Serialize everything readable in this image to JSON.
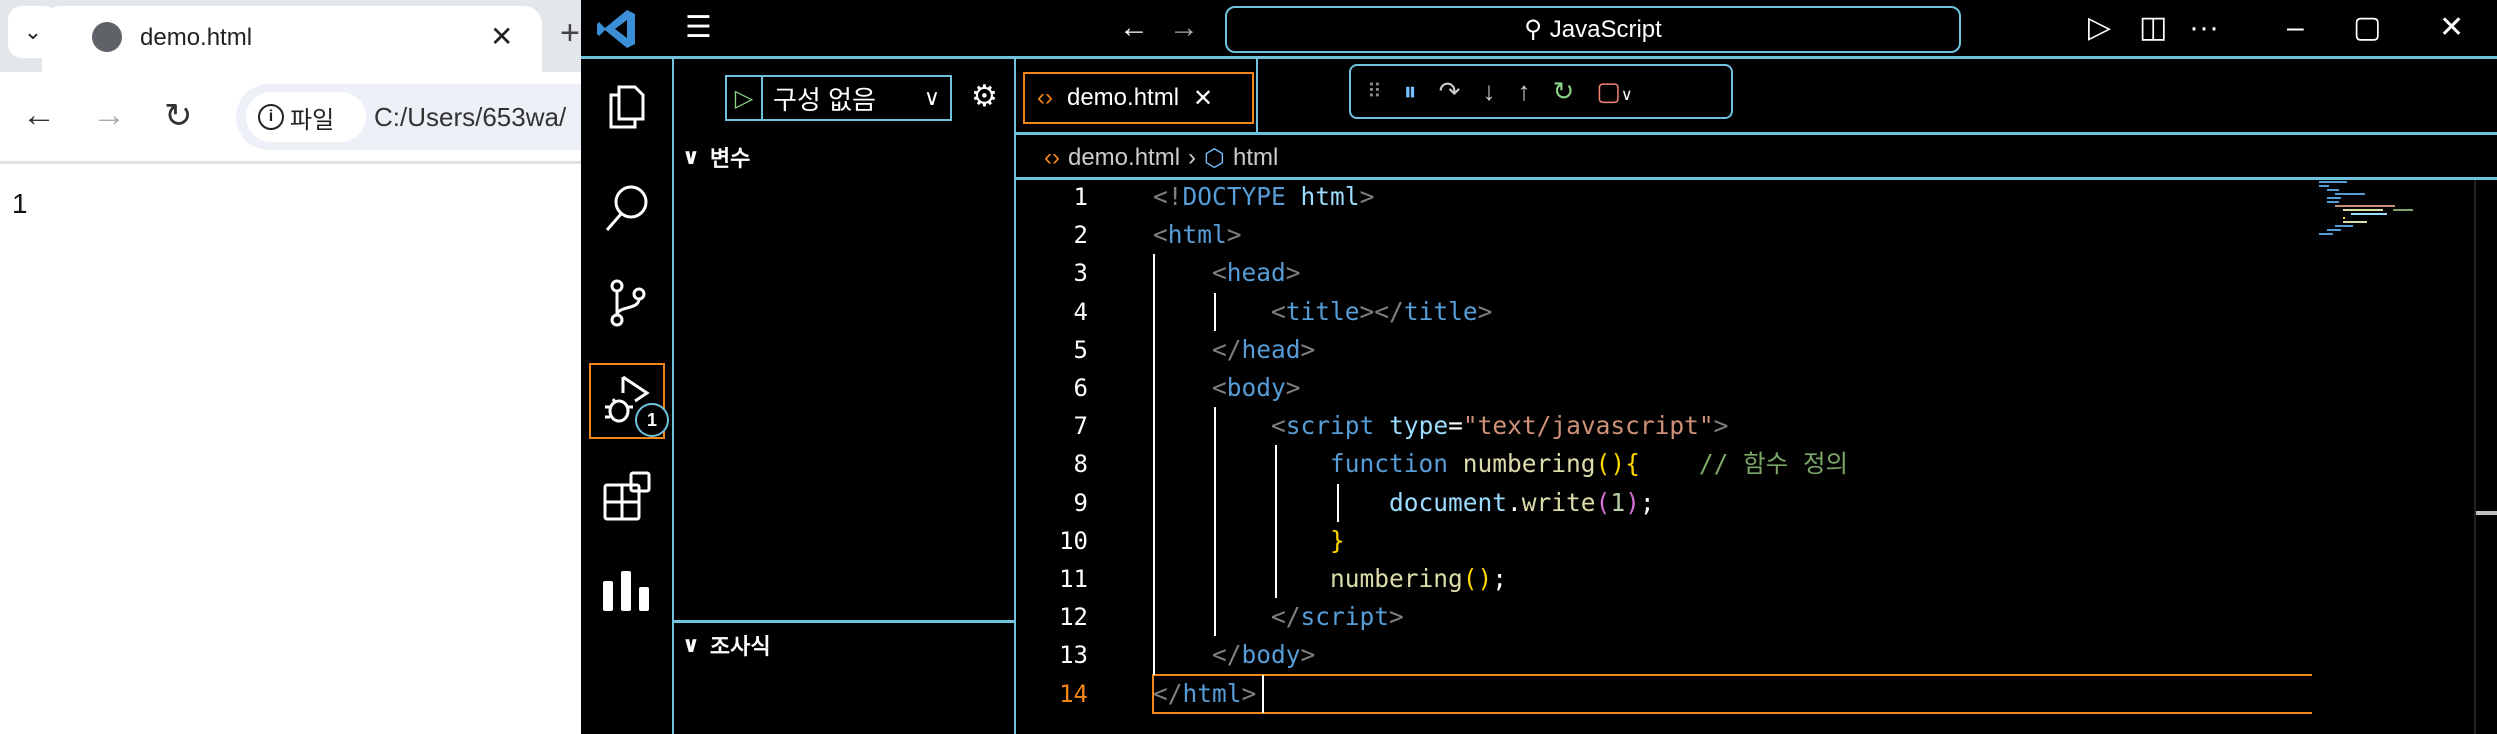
{
  "browser": {
    "tab_title": "demo.html",
    "address_chip": "파일",
    "url": "C:/Users/653wa/",
    "page_output": "1"
  },
  "vscode": {
    "command_center": "JavaScript",
    "sidebar": {
      "run_config": "구성 없음",
      "variables_header": "변수",
      "watch_header": "조사식"
    },
    "debug_badge": "1",
    "editor_tab": "demo.html",
    "breadcrumb": [
      "demo.html",
      "html"
    ],
    "active_line": 14,
    "code_lines": [
      [
        [
          "<!",
          "pu"
        ],
        [
          "DOCTYPE",
          "tg"
        ],
        [
          " ",
          "pl"
        ],
        [
          "html",
          "at"
        ],
        [
          ">",
          "pu"
        ]
      ],
      [
        [
          "<",
          "pu"
        ],
        [
          "html",
          "tg"
        ],
        [
          ">",
          "pu"
        ]
      ],
      [
        [
          "    ",
          "pl"
        ],
        [
          "<",
          "pu"
        ],
        [
          "head",
          "tg"
        ],
        [
          ">",
          "pu"
        ]
      ],
      [
        [
          "        ",
          "pl"
        ],
        [
          "<",
          "pu"
        ],
        [
          "title",
          "tg"
        ],
        [
          "></",
          "pu"
        ],
        [
          "title",
          "tg"
        ],
        [
          ">",
          "pu"
        ]
      ],
      [
        [
          "    ",
          "pl"
        ],
        [
          "</",
          "pu"
        ],
        [
          "head",
          "tg"
        ],
        [
          ">",
          "pu"
        ]
      ],
      [
        [
          "    ",
          "pl"
        ],
        [
          "<",
          "pu"
        ],
        [
          "body",
          "tg"
        ],
        [
          ">",
          "pu"
        ]
      ],
      [
        [
          "        ",
          "pl"
        ],
        [
          "<",
          "pu"
        ],
        [
          "script",
          "tg"
        ],
        [
          " ",
          "pl"
        ],
        [
          "type",
          "at"
        ],
        [
          "=",
          "pl"
        ],
        [
          "\"text/javascript\"",
          "st"
        ],
        [
          ">",
          "pu"
        ]
      ],
      [
        [
          "            ",
          "pl"
        ],
        [
          "function",
          "kw"
        ],
        [
          " ",
          "pl"
        ],
        [
          "numbering",
          "fn"
        ],
        [
          "()",
          "br"
        ],
        [
          "{",
          "br"
        ],
        [
          "    ",
          "pl"
        ],
        [
          "// 함수 정의",
          "cm"
        ]
      ],
      [
        [
          "                ",
          "pl"
        ],
        [
          "document",
          "va"
        ],
        [
          ".",
          "pl"
        ],
        [
          "write",
          "fn"
        ],
        [
          "(",
          "br2"
        ],
        [
          "1",
          "nu"
        ],
        [
          ")",
          "br2"
        ],
        [
          ";",
          "pl"
        ]
      ],
      [
        [
          "            ",
          "pl"
        ],
        [
          "}",
          "br"
        ]
      ],
      [
        [
          "            ",
          "pl"
        ],
        [
          "numbering",
          "fn"
        ],
        [
          "()",
          "br"
        ],
        [
          ";",
          "pl"
        ]
      ],
      [
        [
          "        ",
          "pl"
        ],
        [
          "</",
          "pu"
        ],
        [
          "script",
          "tg"
        ],
        [
          ">",
          "pu"
        ]
      ],
      [
        [
          "    ",
          "pl"
        ],
        [
          "</",
          "pu"
        ],
        [
          "body",
          "tg"
        ],
        [
          ">",
          "pu"
        ]
      ],
      [
        [
          "</",
          "pu"
        ],
        [
          "html",
          "tg"
        ],
        [
          ">",
          "pu"
        ]
      ]
    ]
  }
}
